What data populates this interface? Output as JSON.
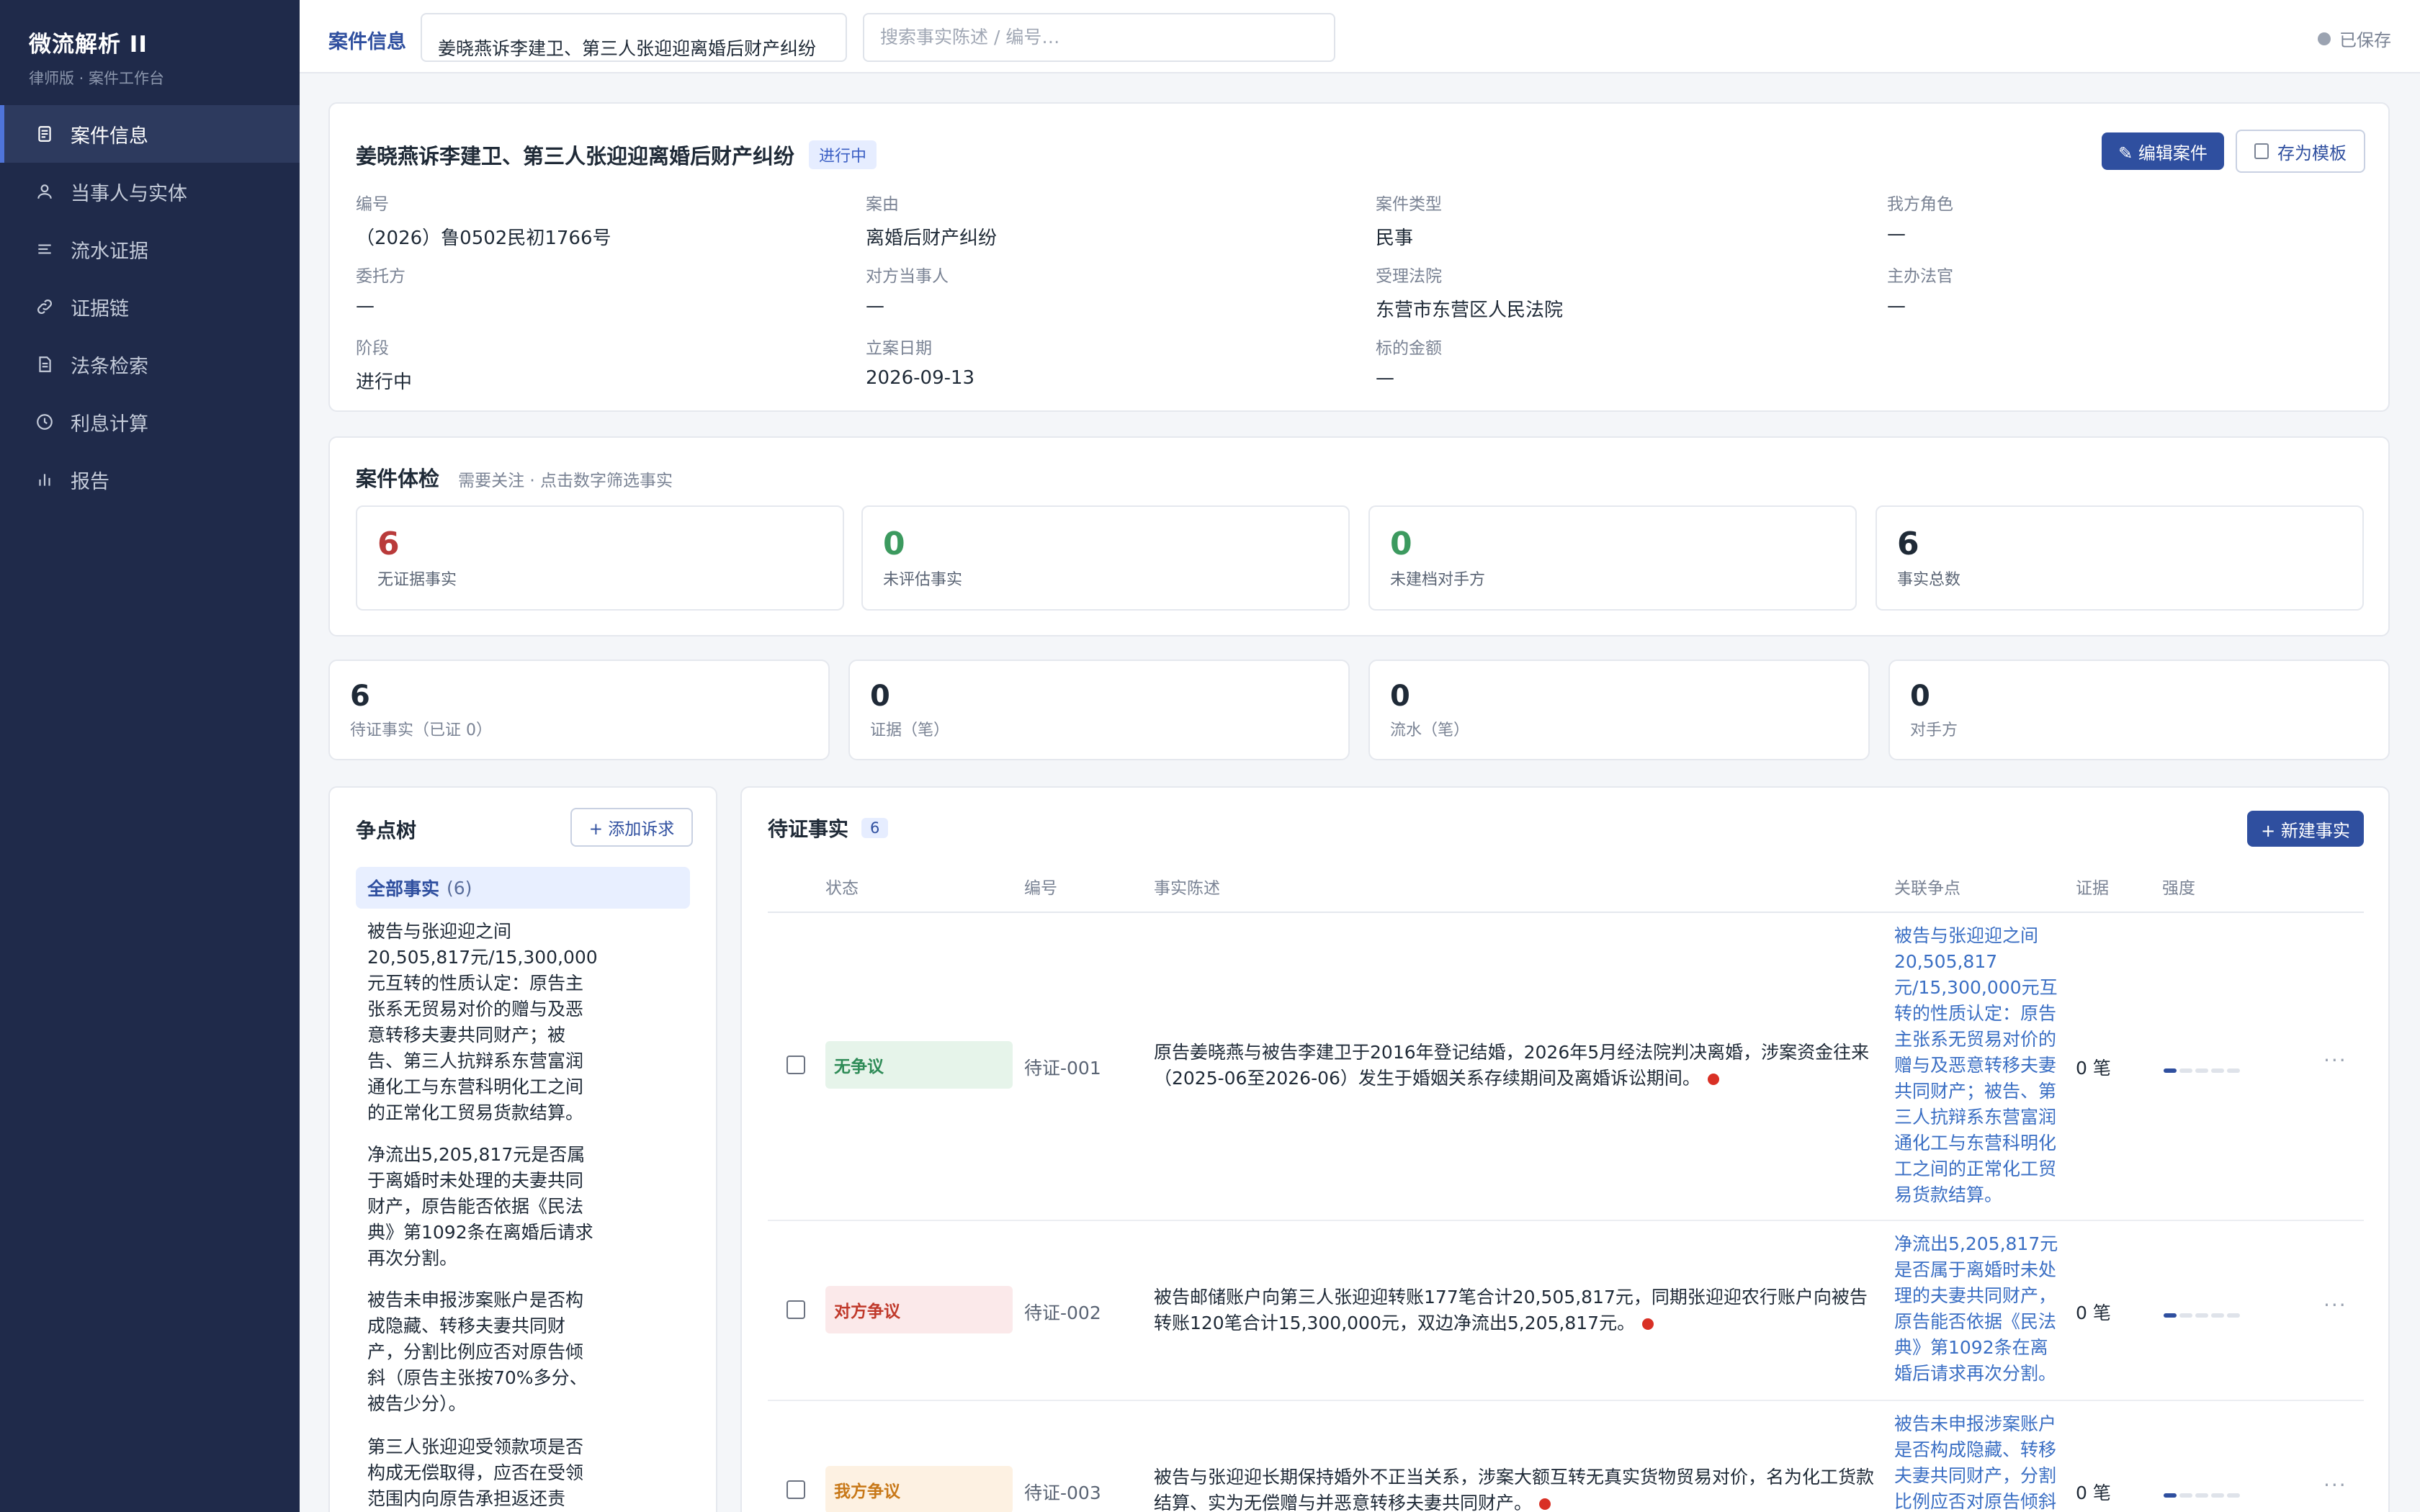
{
  "app": {
    "title": "微流解析 II",
    "subtitle": "律师版 · 案件工作台"
  },
  "sidebar": {
    "items": [
      {
        "label": "案件信息",
        "icon": "document-icon",
        "active": true
      },
      {
        "label": "当事人与实体",
        "icon": "user-icon",
        "active": false
      },
      {
        "label": "流水证据",
        "icon": "list-icon",
        "active": false
      },
      {
        "label": "证据链",
        "icon": "link-icon",
        "active": false
      },
      {
        "label": "法条检索",
        "icon": "file-icon",
        "active": false
      },
      {
        "label": "利息计算",
        "icon": "clock-icon",
        "active": false
      },
      {
        "label": "报告",
        "icon": "bar-chart-icon",
        "active": false
      }
    ]
  },
  "topbar": {
    "tab_label": "案件信息",
    "case_name_value": "姜晓燕诉李建卫、第三人张迎迎离婚后财产纠纷",
    "search_placeholder": "搜索事实陈述 / 编号…",
    "save_status": "已保存"
  },
  "case": {
    "title": "姜晓燕诉李建卫、第三人张迎迎离婚后财产纠纷",
    "status": "进行中",
    "edit_label": "✎ 编辑案件",
    "template_label": "存为模板",
    "fields": [
      {
        "label": "编号",
        "value": "（2026）鲁0502民初1766号"
      },
      {
        "label": "案由",
        "value": "离婚后财产纠纷"
      },
      {
        "label": "案件类型",
        "value": "民事"
      },
      {
        "label": "我方角色",
        "value": "—"
      },
      {
        "label": "委托方",
        "value": "—"
      },
      {
        "label": "对方当事人",
        "value": "—"
      },
      {
        "label": "受理法院",
        "value": "东营市东营区人民法院"
      },
      {
        "label": "主办法官",
        "value": "—"
      },
      {
        "label": "阶段",
        "value": "进行中"
      },
      {
        "label": "立案日期",
        "value": "2026-09-13"
      },
      {
        "label": "标的金额",
        "value": "—"
      }
    ]
  },
  "health": {
    "title": "案件体检",
    "subtitle": "需要关注 · 点击数字筛选事实",
    "metrics": [
      {
        "value": "6",
        "label": "无证据事实",
        "color": "#b93a3a"
      },
      {
        "value": "0",
        "label": "未评估事实",
        "color": "#3c9a5f"
      },
      {
        "value": "0",
        "label": "未建档对手方",
        "color": "#3c9a5f"
      },
      {
        "value": "6",
        "label": "事实总数",
        "color": "#1f2a37"
      }
    ]
  },
  "stats": [
    {
      "value": "6",
      "label": "待证事实（已证 0）"
    },
    {
      "value": "0",
      "label": "证据（笔）"
    },
    {
      "value": "0",
      "label": "流水（笔）"
    },
    {
      "value": "0",
      "label": "对手方"
    }
  ],
  "issue_tree": {
    "title": "争点树",
    "add_label": "+ 添加诉求",
    "all_label": "全部事实",
    "all_count": "(6)",
    "issues": [
      "被告与张迎迎之间20,505,817元/15,300,000元互转的性质认定：原告主张系无贸易对价的赠与及恶意转移夫妻共同财产；被告、第三人抗辩系东营富润通化工与东营科明化工之间的正常化工贸易货款结算。",
      "净流出5,205,817元是否属于离婚时未处理的夫妻共同财产，原告能否依据《民法典》第1092条在离婚后请求再次分割。",
      "被告未申报涉案账户是否构成隐藏、转移夫妻共同财产，分割比例应否对原告倾斜（原告主张按70%多分、被告少分）。",
      "第三人张迎迎受领款项是否构成无偿取得，应否在受领范围内向原告承担返还责任。"
    ]
  },
  "facts": {
    "title": "待证事实",
    "count": "6",
    "new_label": "+ 新建事实",
    "columns": {
      "state": "状态",
      "code": "编号",
      "desc": "事实陈述",
      "issue": "关联争点",
      "evidence": "证据",
      "strength": "强度"
    },
    "rows": [
      {
        "state": "无争议",
        "code": "待证-001",
        "desc": "原告姜晓燕与被告李建卫于2016年登记结婚，2026年5月经法院判决离婚，涉案资金往来（2025-06至2026-06）发生于婚姻关系存续期间及离婚诉讼期间。",
        "issue": "被告与张迎迎之间20,505,817元/15,300,000元互转的性质认定：原告主张系无贸易对价的赠与及恶意转移夫妻共同财产；被告、第三人抗辩系东营富润通化工与东营科明化工之间的正常化工贸易货款结算。",
        "evidence": "0 笔",
        "strength": 0.2
      },
      {
        "state": "对方争议",
        "code": "待证-002",
        "desc": "被告邮储账户向第三人张迎迎转账177笔合计20,505,817元，同期张迎迎农行账户向被告转账120笔合计15,300,000元，双边净流出5,205,817元。",
        "issue": "净流出5,205,817元是否属于离婚时未处理的夫妻共同财产，原告能否依据《民法典》第1092条在离婚后请求再次分割。",
        "evidence": "0 笔",
        "strength": 0.2
      },
      {
        "state": "我方争议",
        "code": "待证-003",
        "desc": "被告与张迎迎长期保持婚外不正当关系，涉案大额互转无真实货物贸易对价，名为化工货款结算、实为无偿赠与并恶意转移夫妻共同财产。",
        "issue": "被告未申报涉案账户是否构成隐藏、转移夫妻共同财产，分割比例应否对原告倾斜",
        "evidence": "0 笔",
        "strength": 0.2
      }
    ]
  },
  "colors": {
    "sidebar_bg": "#1f2a4a",
    "accent": "#2f4f9f",
    "danger": "#b93a3a",
    "success": "#3c9a5f"
  }
}
